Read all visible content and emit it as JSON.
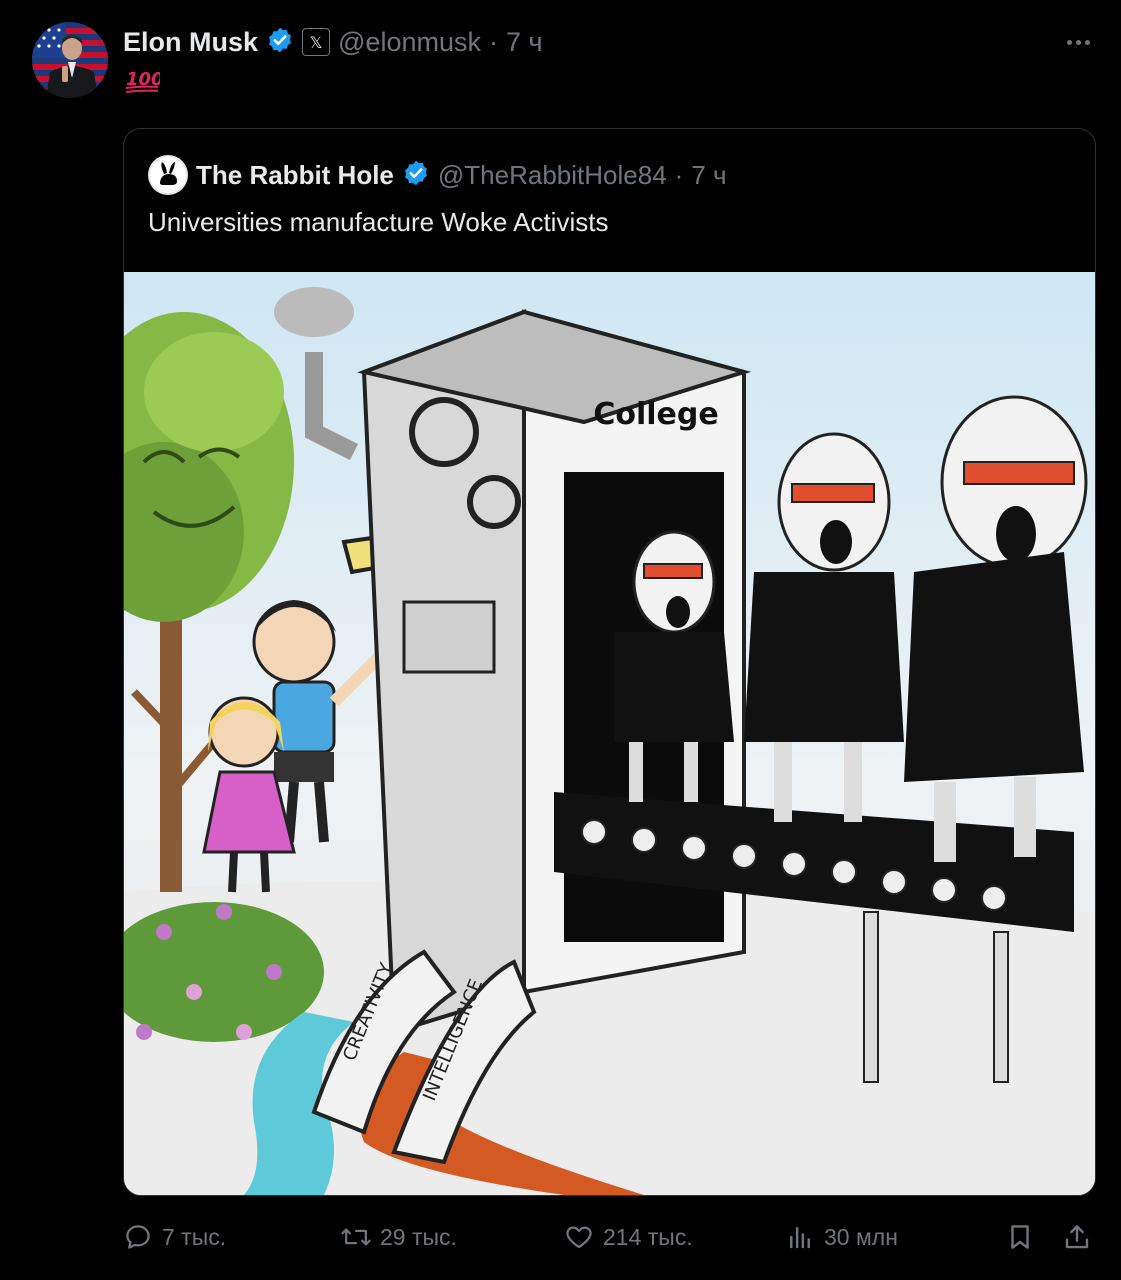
{
  "post": {
    "author_name": "Elon Musk",
    "author_handle": "@elonmusk",
    "separator": "·",
    "time": "7 ч",
    "body": "💯",
    "x_badge": "𝕏"
  },
  "quoted": {
    "author_name": "The Rabbit Hole",
    "author_handle": "@TheRabbitHole84",
    "separator": "·",
    "time": "7 ч",
    "text": "Universities manufacture Woke Activists",
    "image": {
      "sign_text": "College",
      "pipe_label_1": "CREATIVITY",
      "pipe_label_2": "INTELLIGENCE"
    }
  },
  "actions": {
    "replies": "7 тыс.",
    "reposts": "29 тыс.",
    "likes": "214 тыс.",
    "views": "30 млн"
  },
  "colors": {
    "background": "#000000",
    "text": "#e7e9ea",
    "muted": "#71767b",
    "verified": "#1d9bf0",
    "border": "#2f3336"
  }
}
